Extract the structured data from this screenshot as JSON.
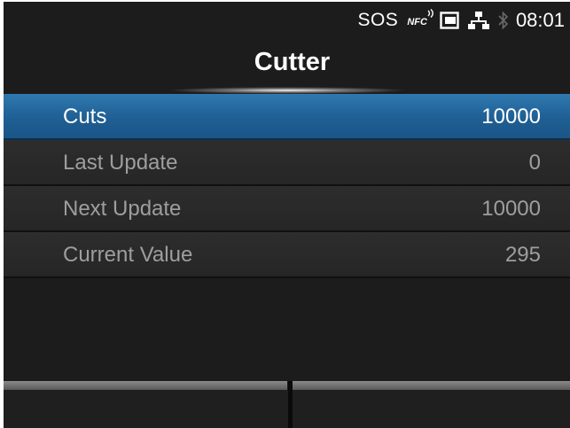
{
  "status_bar": {
    "sos_label": "SOS",
    "nfc_label": "NFC",
    "icons": [
      "nfc-icon",
      "sd-card-icon",
      "lan-icon",
      "bluetooth-icon"
    ],
    "time": "08:01"
  },
  "header": {
    "title": "Cutter"
  },
  "menu": {
    "items": [
      {
        "label": "Cuts",
        "value": "10000",
        "selected": true
      },
      {
        "label": "Last Update",
        "value": "0",
        "selected": false
      },
      {
        "label": "Next Update",
        "value": "10000",
        "selected": false
      },
      {
        "label": "Current Value",
        "value": "295",
        "selected": false
      }
    ]
  },
  "softkeys": {
    "left_label": "",
    "right_label": ""
  },
  "colors": {
    "background": "#1c1c1c",
    "selected_row": "#1f5f94",
    "row": "#2a2a2a",
    "text_active": "#ffffff",
    "text_inactive": "#9e9e9e"
  }
}
